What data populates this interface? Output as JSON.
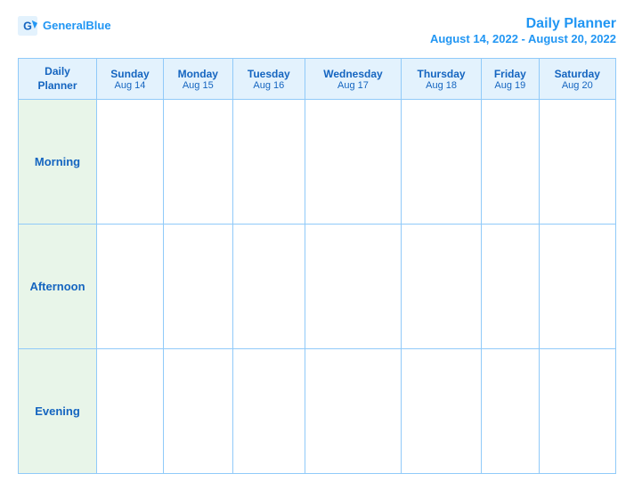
{
  "header": {
    "logo_general": "General",
    "logo_blue": "Blue",
    "title": "Daily Planner",
    "date_range": "August 14, 2022 - August 20, 2022"
  },
  "table": {
    "label_row1": "Daily",
    "label_row2": "Planner",
    "columns": [
      {
        "day": "Sunday",
        "date": "Aug 14"
      },
      {
        "day": "Monday",
        "date": "Aug 15"
      },
      {
        "day": "Tuesday",
        "date": "Aug 16"
      },
      {
        "day": "Wednesday",
        "date": "Aug 17"
      },
      {
        "day": "Thursday",
        "date": "Aug 18"
      },
      {
        "day": "Friday",
        "date": "Aug 19"
      },
      {
        "day": "Saturday",
        "date": "Aug 20"
      }
    ],
    "rows": [
      {
        "label": "Morning"
      },
      {
        "label": "Afternoon"
      },
      {
        "label": "Evening"
      }
    ]
  }
}
